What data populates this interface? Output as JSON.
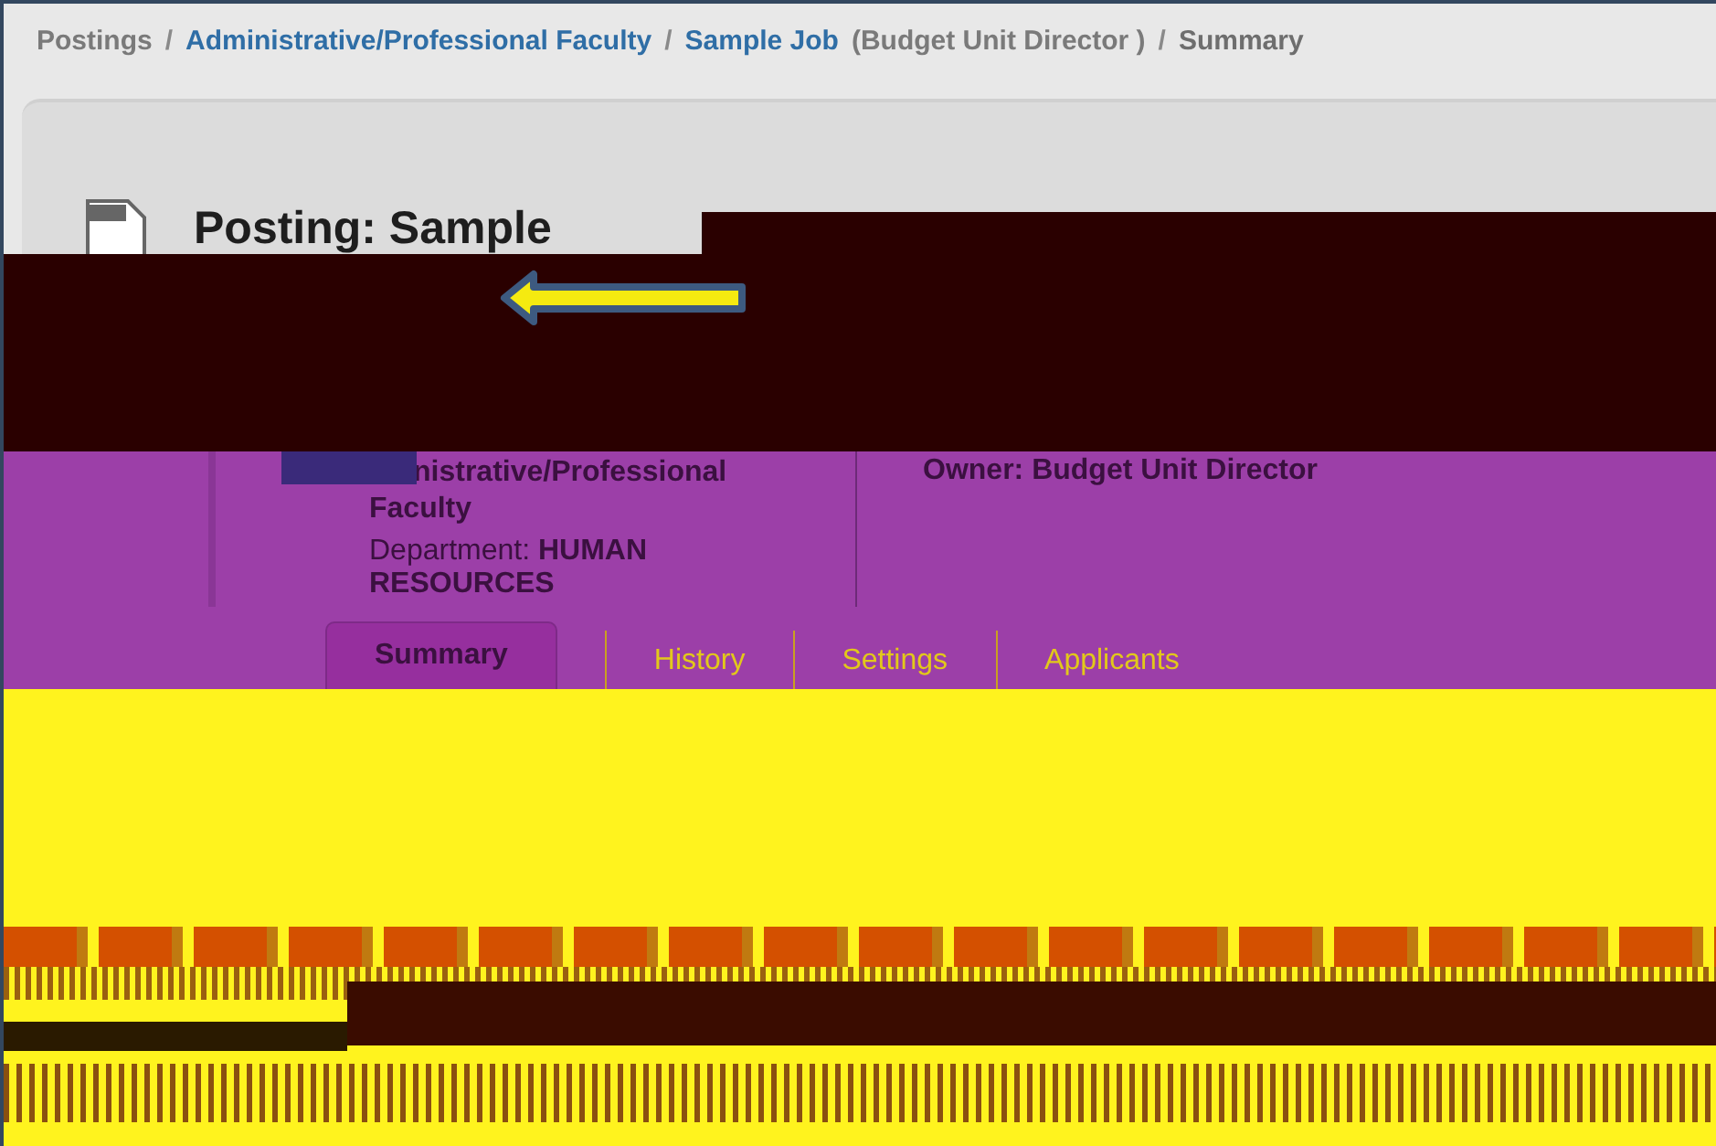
{
  "breadcrumb": [
    {
      "kind": "plain",
      "text": "Postings"
    },
    {
      "kind": "separator",
      "text": "/"
    },
    {
      "kind": "link",
      "text": "Administrative/Professional Faculty"
    },
    {
      "kind": "separator",
      "text": "/"
    },
    {
      "kind": "link",
      "text": "Sample Job"
    },
    {
      "kind": "plain",
      "text": "(Budget Unit Director )"
    },
    {
      "kind": "separator",
      "text": "/"
    },
    {
      "kind": "current",
      "text": "Summary"
    }
  ],
  "title": "Posting: Sample",
  "category": "nistrative/Professional Faculty",
  "department": "Department: **HUMAN RESOURCES**",
  "owner": "Owner: Budget Unit Director",
  "tabs": [
    {
      "label": "Summary",
      "selected": true
    },
    {
      "label": "History",
      "selected": false
    },
    {
      "label": "Settings",
      "selected": false
    },
    {
      "label": "Applicants",
      "selected": false
    }
  ]
}
